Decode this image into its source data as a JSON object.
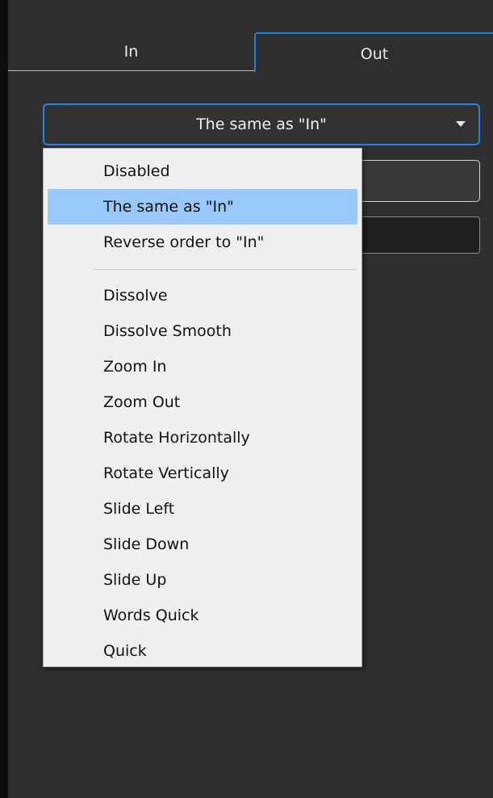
{
  "tabs": [
    {
      "label": "In",
      "active": false
    },
    {
      "label": "Out",
      "active": true
    }
  ],
  "select": {
    "value": "The same as \"In\"",
    "icon": "chevron-down-icon"
  },
  "dropdown": {
    "group1": [
      {
        "label": "Disabled"
      },
      {
        "label": "The same as \"In\"",
        "selected": true
      },
      {
        "label": "Reverse order to \"In\""
      }
    ],
    "group2": [
      {
        "label": "Dissolve"
      },
      {
        "label": "Dissolve Smooth"
      },
      {
        "label": "Zoom In"
      },
      {
        "label": "Zoom Out"
      },
      {
        "label": "Rotate Horizontally"
      },
      {
        "label": "Rotate Vertically"
      },
      {
        "label": "Slide Left"
      },
      {
        "label": "Slide Down"
      },
      {
        "label": "Slide Up"
      },
      {
        "label": "Words Quick"
      },
      {
        "label": "Quick"
      }
    ]
  },
  "colors": {
    "accent": "#1f86e8",
    "selected_bg": "#98c9f8",
    "panel_bg": "#2f2f2f",
    "menu_bg": "#f0f0f0"
  }
}
